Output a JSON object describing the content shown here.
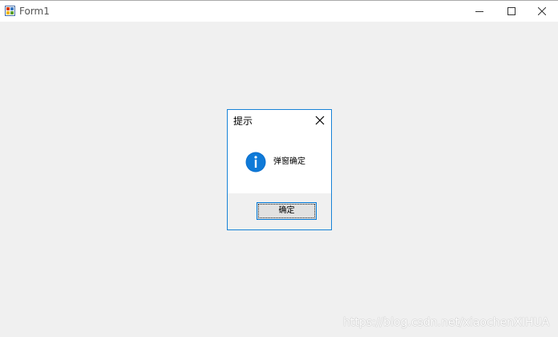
{
  "window": {
    "title": "Form1"
  },
  "dialog": {
    "title": "提示",
    "message": "弹窗确定",
    "ok_label": "确定",
    "icon": "info-icon",
    "accent_color": "#1883d7"
  },
  "watermark": {
    "text": "https://blog.csdn.net/xiaochenXIHUA"
  }
}
